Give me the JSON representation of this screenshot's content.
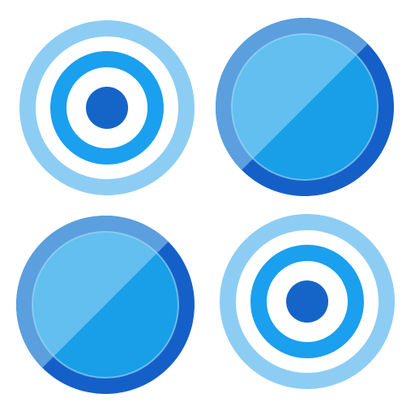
{
  "icon": {
    "tiles": [
      {
        "kind": "target-rings"
      },
      {
        "kind": "glossy-disc"
      },
      {
        "kind": "glossy-disc"
      },
      {
        "kind": "target-rings"
      }
    ]
  },
  "colors": {
    "ring_light": "#8dcdf4",
    "ring_mid": "#1aa0ee",
    "ring_dark": "#1565c8",
    "disc_border_light": "#5b9fde",
    "disc_border_dark": "#1560c8",
    "disc_fill_light": "#62bff0",
    "disc_fill_dark": "#199ee8",
    "background": "#ffffff"
  }
}
